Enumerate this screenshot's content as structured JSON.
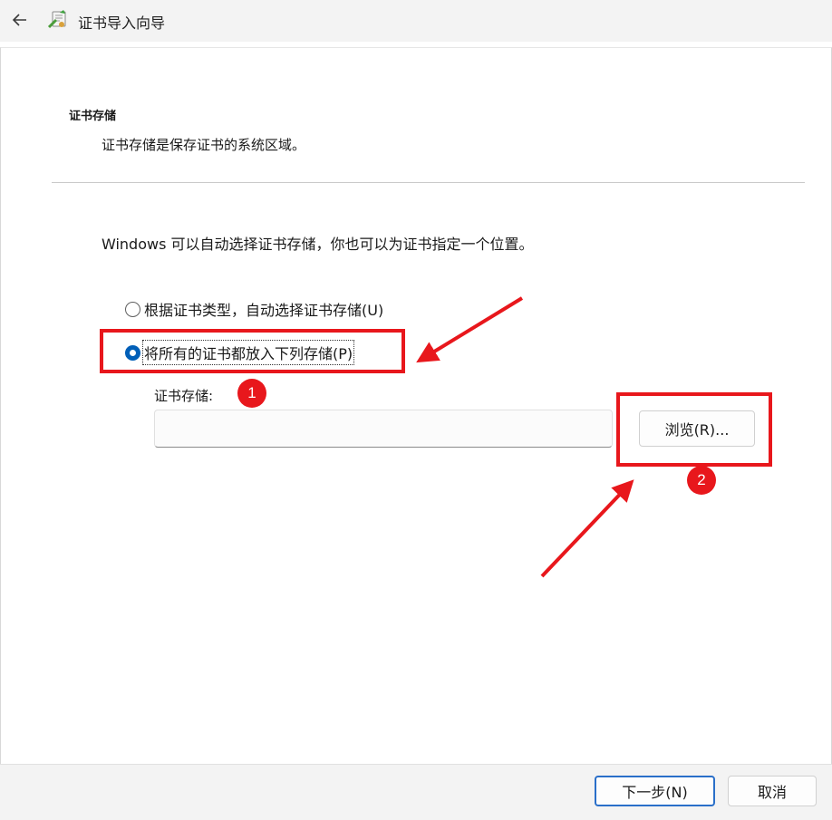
{
  "window": {
    "title": "证书导入向导",
    "back_icon": "back-arrow-icon",
    "app_icon": "certificate-wizard-icon"
  },
  "section": {
    "title": "证书存储",
    "description": "证书存储是保存证书的系统区域。"
  },
  "instruction": "Windows 可以自动选择证书存储，你也可以为证书指定一个位置。",
  "options": [
    {
      "label": "根据证书类型，自动选择证书存储(U)",
      "checked": false
    },
    {
      "label": "将所有的证书都放入下列存储(P)",
      "checked": true
    }
  ],
  "store": {
    "label": "证书存储:",
    "value": "",
    "browse_label": "浏览(R)..."
  },
  "footer": {
    "next_label": "下一步(N)",
    "cancel_label": "取消"
  },
  "annotations": {
    "badge_1": "1",
    "badge_2": "2",
    "highlight_color": "#e8171c"
  },
  "colors": {
    "accent": "#005fb8",
    "chrome": "#f3f3f3"
  }
}
